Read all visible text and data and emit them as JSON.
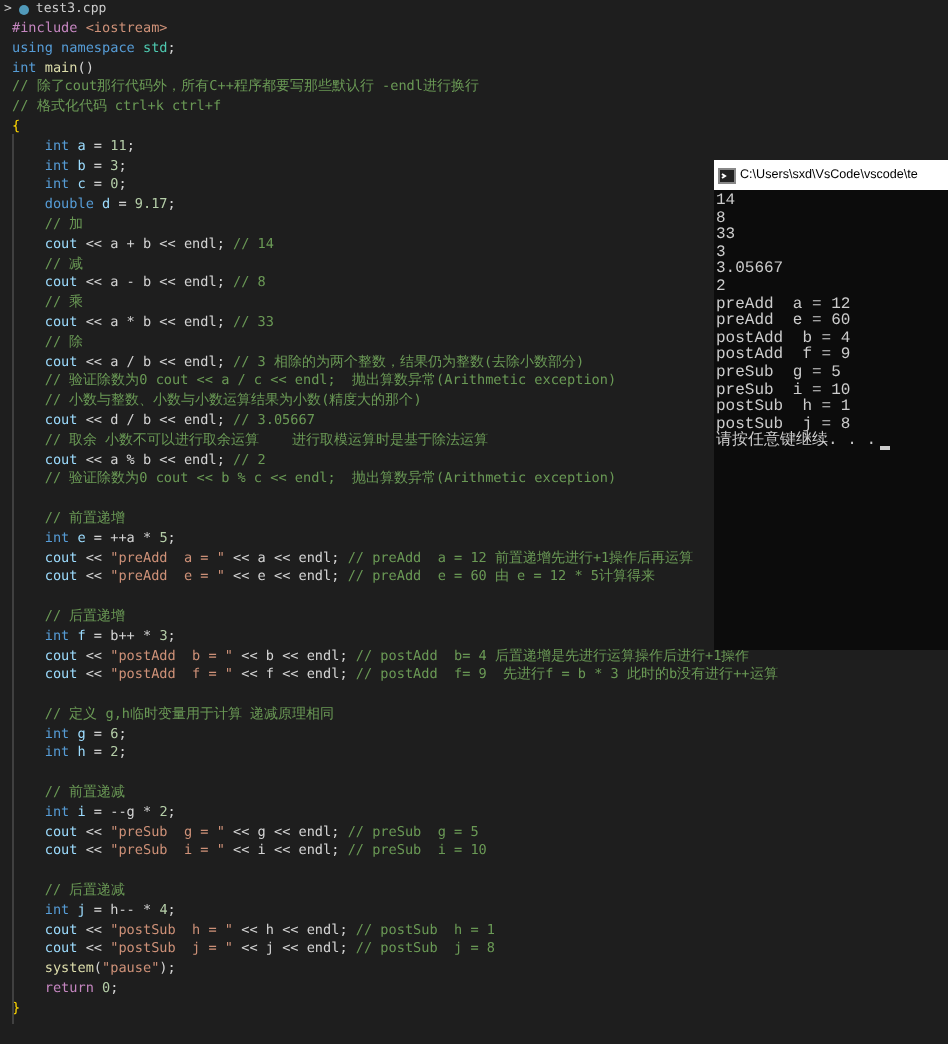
{
  "editor": {
    "tab": {
      "chevron": ">",
      "file": "test3.cpp"
    },
    "blocks": [
      [
        [
          {
            "kind": "pp",
            "text": "#include "
          },
          {
            "kind": "str",
            "text": "<iostream>"
          }
        ],
        [
          {
            "kind": "kw",
            "text": "using namespace "
          },
          {
            "kind": "ty",
            "text": "std"
          },
          {
            "kind": "op",
            "text": ";"
          }
        ],
        [
          {
            "kind": "kw",
            "text": "int "
          },
          {
            "kind": "fn",
            "text": "main"
          },
          {
            "kind": "op",
            "text": "()"
          }
        ],
        [
          {
            "kind": "cm",
            "text": "// 除了cout那行代码外，所有C++程序都要写那些默认行 -endl进行换行"
          }
        ],
        [
          {
            "kind": "cm",
            "text": "// 格式化代码 ctrl+k ctrl+f"
          }
        ],
        [
          {
            "kind": "br",
            "text": "{"
          }
        ],
        [
          {
            "kind": "kw",
            "text": "    int "
          },
          {
            "kind": "var",
            "text": "a"
          },
          {
            "kind": "op",
            "text": " = "
          },
          {
            "kind": "num",
            "text": "11"
          },
          {
            "kind": "op",
            "text": ";"
          }
        ],
        [
          {
            "kind": "kw",
            "text": "    int "
          },
          {
            "kind": "var",
            "text": "b"
          },
          {
            "kind": "op",
            "text": " = "
          },
          {
            "kind": "num",
            "text": "3"
          },
          {
            "kind": "op",
            "text": ";"
          }
        ],
        [
          {
            "kind": "kw",
            "text": "    int "
          },
          {
            "kind": "var",
            "text": "c"
          },
          {
            "kind": "op",
            "text": " = "
          },
          {
            "kind": "num",
            "text": "0"
          },
          {
            "kind": "op",
            "text": ";"
          }
        ],
        [
          {
            "kind": "kw",
            "text": "    double "
          },
          {
            "kind": "var",
            "text": "d"
          },
          {
            "kind": "op",
            "text": " = "
          },
          {
            "kind": "num",
            "text": "9.17"
          },
          {
            "kind": "op",
            "text": ";"
          }
        ],
        [
          {
            "kind": "cm",
            "text": "    // 加"
          }
        ],
        [
          {
            "kind": "var",
            "text": "    cout"
          },
          {
            "kind": "op",
            "text": " << a + b << endl; "
          },
          {
            "kind": "cm",
            "text": "// 14"
          }
        ],
        [
          {
            "kind": "cm",
            "text": "    // 减"
          }
        ],
        [
          {
            "kind": "var",
            "text": "    cout"
          },
          {
            "kind": "op",
            "text": " << a - b << endl; "
          },
          {
            "kind": "cm",
            "text": "// 8"
          }
        ],
        [
          {
            "kind": "cm",
            "text": "    // 乘"
          }
        ],
        [
          {
            "kind": "var",
            "text": "    cout"
          },
          {
            "kind": "op",
            "text": " << a * b << endl; "
          },
          {
            "kind": "cm",
            "text": "// 33"
          }
        ],
        [
          {
            "kind": "cm",
            "text": "    // 除"
          }
        ],
        [
          {
            "kind": "var",
            "text": "    cout"
          },
          {
            "kind": "op",
            "text": " << a / b << endl; "
          },
          {
            "kind": "cm",
            "text": "// 3 相除的为两个整数，结果仍为整数(去除小数部分)"
          }
        ],
        [
          {
            "kind": "cm",
            "text": "    // 验证除数为0 cout << a / c << endl;  抛出算数异常(Arithmetic exception)"
          }
        ],
        [
          {
            "kind": "cm",
            "text": "    // 小数与整数、小数与小数运算结果为小数(精度大的那个)"
          }
        ],
        [
          {
            "kind": "var",
            "text": "    cout"
          },
          {
            "kind": "op",
            "text": " << d / b << endl; "
          },
          {
            "kind": "cm",
            "text": "// 3.05667"
          }
        ],
        [
          {
            "kind": "cm",
            "text": "    // 取余 小数不可以进行取余运算    进行取模运算时是基于除法运算"
          }
        ],
        [
          {
            "kind": "var",
            "text": "    cout"
          },
          {
            "kind": "op",
            "text": " << a % b << endl; "
          },
          {
            "kind": "cm",
            "text": "// 2"
          }
        ],
        [
          {
            "kind": "cm",
            "text": "    // 验证除数为0 cout << b % c << endl;  抛出算数异常(Arithmetic exception)"
          }
        ]
      ],
      [
        [
          {
            "kind": "cm",
            "text": "    // 前置递增"
          }
        ],
        [
          {
            "kind": "kw",
            "text": "    int "
          },
          {
            "kind": "var",
            "text": "e"
          },
          {
            "kind": "op",
            "text": " = ++a * "
          },
          {
            "kind": "num",
            "text": "5"
          },
          {
            "kind": "op",
            "text": ";"
          }
        ],
        [
          {
            "kind": "var",
            "text": "    cout"
          },
          {
            "kind": "op",
            "text": " << "
          },
          {
            "kind": "str",
            "text": "\"preAdd  a = \""
          },
          {
            "kind": "op",
            "text": " << a << endl; "
          },
          {
            "kind": "cm",
            "text": "// preAdd  a = 12 前置递增先进行+1操作后再运算"
          }
        ],
        [
          {
            "kind": "var",
            "text": "    cout"
          },
          {
            "kind": "op",
            "text": " << "
          },
          {
            "kind": "str",
            "text": "\"preAdd  e = \""
          },
          {
            "kind": "op",
            "text": " << e << endl; "
          },
          {
            "kind": "cm",
            "text": "// preAdd  e = 60 由 e = 12 * 5计算得来"
          }
        ]
      ],
      [
        [
          {
            "kind": "cm",
            "text": "    // 后置递增"
          }
        ],
        [
          {
            "kind": "kw",
            "text": "    int "
          },
          {
            "kind": "var",
            "text": "f"
          },
          {
            "kind": "op",
            "text": " = b++ * "
          },
          {
            "kind": "num",
            "text": "3"
          },
          {
            "kind": "op",
            "text": ";"
          }
        ],
        [
          {
            "kind": "var",
            "text": "    cout"
          },
          {
            "kind": "op",
            "text": " << "
          },
          {
            "kind": "str",
            "text": "\"postAdd  b = \""
          },
          {
            "kind": "op",
            "text": " << b << endl; "
          },
          {
            "kind": "cm",
            "text": "// postAdd  b= 4 后置递增是先进行运算操作后进行+1操作"
          }
        ],
        [
          {
            "kind": "var",
            "text": "    cout"
          },
          {
            "kind": "op",
            "text": " << "
          },
          {
            "kind": "str",
            "text": "\"postAdd  f = \""
          },
          {
            "kind": "op",
            "text": " << f << endl; "
          },
          {
            "kind": "cm",
            "text": "// postAdd  f= 9  先进行f = b * 3 此时的b没有进行++运算"
          }
        ]
      ],
      [
        [
          {
            "kind": "cm",
            "text": "    // 定义 g,h临时变量用于计算 递减原理相同"
          }
        ],
        [
          {
            "kind": "kw",
            "text": "    int "
          },
          {
            "kind": "var",
            "text": "g"
          },
          {
            "kind": "op",
            "text": " = "
          },
          {
            "kind": "num",
            "text": "6"
          },
          {
            "kind": "op",
            "text": ";"
          }
        ],
        [
          {
            "kind": "kw",
            "text": "    int "
          },
          {
            "kind": "var",
            "text": "h"
          },
          {
            "kind": "op",
            "text": " = "
          },
          {
            "kind": "num",
            "text": "2"
          },
          {
            "kind": "op",
            "text": ";"
          }
        ]
      ],
      [
        [
          {
            "kind": "cm",
            "text": "    // 前置递减"
          }
        ],
        [
          {
            "kind": "kw",
            "text": "    int "
          },
          {
            "kind": "var",
            "text": "i"
          },
          {
            "kind": "op",
            "text": " = --g * "
          },
          {
            "kind": "num",
            "text": "2"
          },
          {
            "kind": "op",
            "text": ";"
          }
        ],
        [
          {
            "kind": "var",
            "text": "    cout"
          },
          {
            "kind": "op",
            "text": " << "
          },
          {
            "kind": "str",
            "text": "\"preSub  g = \""
          },
          {
            "kind": "op",
            "text": " << g << endl; "
          },
          {
            "kind": "cm",
            "text": "// preSub  g = 5"
          }
        ],
        [
          {
            "kind": "var",
            "text": "    cout"
          },
          {
            "kind": "op",
            "text": " << "
          },
          {
            "kind": "str",
            "text": "\"preSub  i = \""
          },
          {
            "kind": "op",
            "text": " << i << endl; "
          },
          {
            "kind": "cm",
            "text": "// preSub  i = 10"
          }
        ]
      ],
      [
        [
          {
            "kind": "cm",
            "text": "    // 后置递减"
          }
        ],
        [
          {
            "kind": "kw",
            "text": "    int "
          },
          {
            "kind": "var",
            "text": "j"
          },
          {
            "kind": "op",
            "text": " = h-- * "
          },
          {
            "kind": "num",
            "text": "4"
          },
          {
            "kind": "op",
            "text": ";"
          }
        ],
        [
          {
            "kind": "var",
            "text": "    cout"
          },
          {
            "kind": "op",
            "text": " << "
          },
          {
            "kind": "str",
            "text": "\"postSub  h = \""
          },
          {
            "kind": "op",
            "text": " << h << endl; "
          },
          {
            "kind": "cm",
            "text": "// postSub  h = 1"
          }
        ],
        [
          {
            "kind": "var",
            "text": "    cout"
          },
          {
            "kind": "op",
            "text": " << "
          },
          {
            "kind": "str",
            "text": "\"postSub  j = \""
          },
          {
            "kind": "op",
            "text": " << j << endl; "
          },
          {
            "kind": "cm",
            "text": "// postSub  j = 8"
          }
        ],
        [
          {
            "kind": "fn",
            "text": "    system"
          },
          {
            "kind": "op",
            "text": "("
          },
          {
            "kind": "str",
            "text": "\"pause\""
          },
          {
            "kind": "op",
            "text": ");"
          }
        ],
        [
          {
            "kind": "pp",
            "text": "    return "
          },
          {
            "kind": "num",
            "text": "0"
          },
          {
            "kind": "op",
            "text": ";"
          }
        ],
        [
          {
            "kind": "br",
            "text": "}"
          }
        ]
      ]
    ]
  },
  "console": {
    "title": "C:\\Users\\sxd\\VsCode\\vscode\\te",
    "output": [
      "14",
      "8",
      "33",
      "3",
      "3.05667",
      "2",
      "preAdd  a = 12",
      "preAdd  e = 60",
      "postAdd  b = 4",
      "postAdd  f = 9",
      "preSub  g = 5",
      "preSub  i = 10",
      "postSub  h = 1",
      "postSub  j = 8"
    ],
    "prompt": "请按任意键继续. . ."
  }
}
